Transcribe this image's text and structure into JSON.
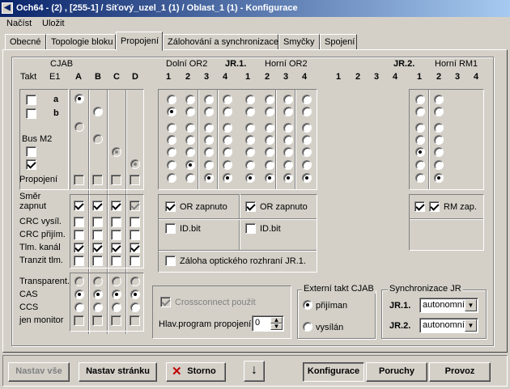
{
  "window": {
    "title": "Och64 - (2) , [255-1] / Síťový_uzel_1 (1) / Oblast_1 (1) - Konfigurace"
  },
  "menu": {
    "load": "Načíst",
    "save": "Uložit"
  },
  "tabs": [
    "Obecné",
    "Topologie bloku",
    "Propojení",
    "Zálohování a synchronizace",
    "Smyčky",
    "Spojení"
  ],
  "active_tab": "Propojení",
  "columns": {
    "takt": "Takt",
    "cjab": "CJAB",
    "e1": "E1",
    "a": "A",
    "b": "B",
    "c": "C",
    "d": "D",
    "dolni_or2": "Dolní OR2",
    "jr1": "JR.1.",
    "horni_or2": "Horní OR2",
    "jr2": "JR.2.",
    "horni_rm1": "Horní RM1",
    "n1": "1",
    "n2": "2",
    "n3": "3",
    "n4": "4"
  },
  "left": {
    "a": "a",
    "b": "b",
    "bus_m2": "Bus M2",
    "propojeni": "Propojení",
    "smer": "Směr",
    "zapnut": "zapnut",
    "crc_vysil": "CRC vysíl.",
    "crc_prijim": "CRC přijím.",
    "tlm_kanal": "Tlm. kanál",
    "tranzit": "Tranzit tlm.",
    "transparent": "Transparent.",
    "cas": "CAS",
    "ccs": "CCS",
    "jen_monitor": "jen monitor"
  },
  "or_group": {
    "or_zapnuto_1": "OR zapnuto",
    "or_zapnuto_2": "OR zapnuto",
    "id_bit_1": "ID.bit",
    "id_bit_2": "ID.bit",
    "zaloha": "Záloha optického rozhraní JR.1."
  },
  "rm": {
    "rm_zap": "RM zap."
  },
  "crossconnect": {
    "label": "Crossconnect použit",
    "hlav": "Hlav.program propojení",
    "hlav_value": "0"
  },
  "ext_takt": {
    "title": "Externí takt CJAB",
    "prijiman": "přijíman",
    "vysilan": "vysílán"
  },
  "sync": {
    "title": "Synchronizace JR",
    "jr1": "JR.1.",
    "jr2": "JR.2.",
    "jr1_value": "autonomní",
    "jr2_value": "autonomní"
  },
  "buttons": {
    "nastav_vse": "Nastav vše",
    "nastav_stranku": "Nastav stránku",
    "storno": "Storno",
    "down": "↓",
    "konfigurace": "Konfigurace",
    "poruchy": "Poruchy",
    "provoz": "Provoz"
  }
}
